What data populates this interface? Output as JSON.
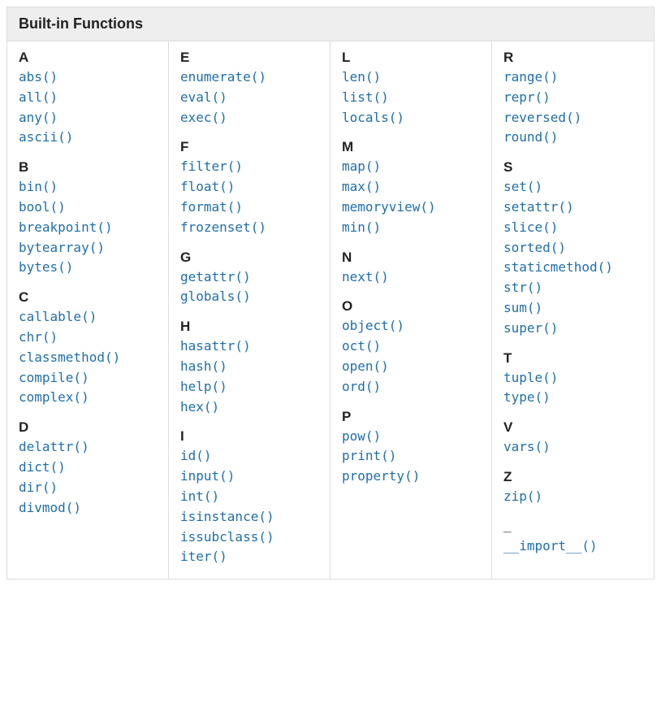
{
  "title": "Built-in Functions",
  "columns": [
    [
      {
        "letter": "A",
        "functions": [
          "abs()",
          "all()",
          "any()",
          "ascii()"
        ]
      },
      {
        "letter": "B",
        "functions": [
          "bin()",
          "bool()",
          "breakpoint()",
          "bytearray()",
          "bytes()"
        ]
      },
      {
        "letter": "C",
        "functions": [
          "callable()",
          "chr()",
          "classmethod()",
          "compile()",
          "complex()"
        ]
      },
      {
        "letter": "D",
        "functions": [
          "delattr()",
          "dict()",
          "dir()",
          "divmod()"
        ]
      }
    ],
    [
      {
        "letter": "E",
        "functions": [
          "enumerate()",
          "eval()",
          "exec()"
        ]
      },
      {
        "letter": "F",
        "functions": [
          "filter()",
          "float()",
          "format()",
          "frozenset()"
        ]
      },
      {
        "letter": "G",
        "functions": [
          "getattr()",
          "globals()"
        ]
      },
      {
        "letter": "H",
        "functions": [
          "hasattr()",
          "hash()",
          "help()",
          "hex()"
        ]
      },
      {
        "letter": "I",
        "functions": [
          "id()",
          "input()",
          "int()",
          "isinstance()",
          "issubclass()",
          "iter()"
        ]
      }
    ],
    [
      {
        "letter": "L",
        "functions": [
          "len()",
          "list()",
          "locals()"
        ]
      },
      {
        "letter": "M",
        "functions": [
          "map()",
          "max()",
          "memoryview()",
          "min()"
        ]
      },
      {
        "letter": "N",
        "functions": [
          "next()"
        ]
      },
      {
        "letter": "O",
        "functions": [
          "object()",
          "oct()",
          "open()",
          "ord()"
        ]
      },
      {
        "letter": "P",
        "functions": [
          "pow()",
          "print()",
          "property()"
        ]
      }
    ],
    [
      {
        "letter": "R",
        "functions": [
          "range()",
          "repr()",
          "reversed()",
          "round()"
        ]
      },
      {
        "letter": "S",
        "functions": [
          "set()",
          "setattr()",
          "slice()",
          "sorted()",
          "staticmethod()",
          "str()",
          "sum()",
          "super()"
        ]
      },
      {
        "letter": "T",
        "functions": [
          "tuple()",
          "type()"
        ]
      },
      {
        "letter": "V",
        "functions": [
          "vars()"
        ]
      },
      {
        "letter": "Z",
        "functions": [
          "zip()"
        ]
      },
      {
        "letter": "_",
        "functions": [
          "__import__()"
        ]
      }
    ]
  ]
}
